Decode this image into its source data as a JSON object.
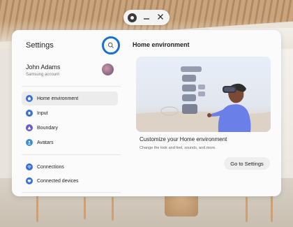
{
  "window": {
    "minimize_icon": "minimize-icon",
    "close_icon": "close-icon"
  },
  "sidebar": {
    "title": "Settings",
    "search_icon": "search-icon",
    "account": {
      "name": "John Adams",
      "subtitle": "Samsung account"
    },
    "groups": [
      [
        {
          "id": "home-environment",
          "label": "Home environment",
          "icon": "home-icon",
          "color": "#3b6fd8",
          "selected": true
        },
        {
          "id": "input",
          "label": "Input",
          "icon": "input-icon",
          "color": "#3b6fd8",
          "selected": false
        },
        {
          "id": "boundary",
          "label": "Boundary",
          "icon": "boundary-icon",
          "color": "#6a5acd",
          "selected": false
        },
        {
          "id": "avatars",
          "label": "Avatars",
          "icon": "avatar-icon",
          "color": "#3b8fd8",
          "selected": false
        }
      ],
      [
        {
          "id": "connections",
          "label": "Connections",
          "icon": "wifi-icon",
          "color": "#3b6fd8",
          "selected": false
        },
        {
          "id": "connected-devices",
          "label": "Connected devices",
          "icon": "devices-icon",
          "color": "#3b6fd8",
          "selected": false
        }
      ]
    ]
  },
  "content": {
    "title": "Home environment",
    "customize_title": "Customize your Home environment",
    "customize_subtitle": "Change the look and feel, sounds, and more.",
    "button_label": "Go to Settings"
  },
  "colors": {
    "accent": "#1a6fd6",
    "selected_bg": "#ececec"
  }
}
